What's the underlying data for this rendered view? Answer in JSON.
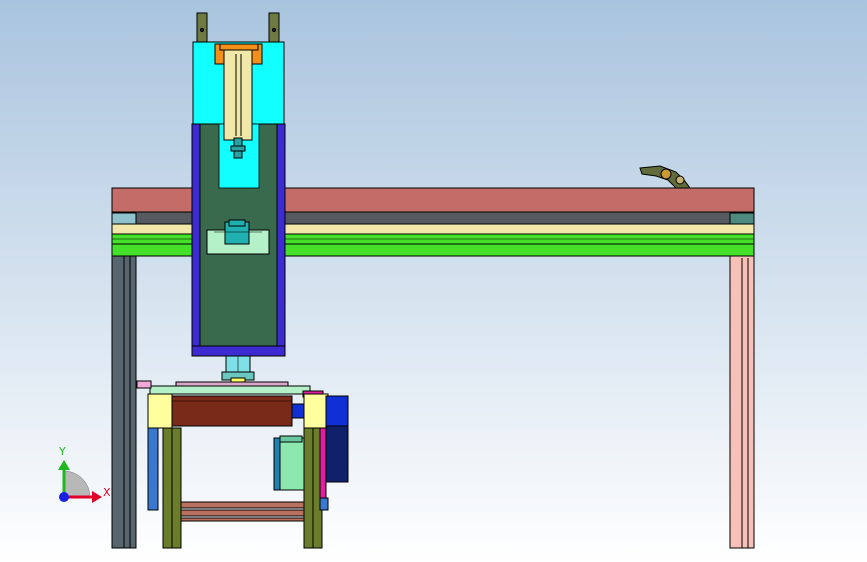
{
  "viewport": {
    "background_top": "#a9c4de",
    "background_bottom": "#ffffff"
  },
  "triad": {
    "x_label": "X",
    "y_label": "Y",
    "x_color": "#e0002a",
    "y_color": "#1fb81f",
    "z_color": "#1a20e0"
  },
  "colors": {
    "outline": "#000000",
    "beam_top": "#c46c68",
    "beam_bottom_band": "#545a60",
    "rail_yellow": "#f1e7a8",
    "rail_green": "#44e02a",
    "column_left": "#56656e",
    "column_right": "#f7c0b8",
    "ram_cyan": "#12ffff",
    "ram_body": "#3a6a4e",
    "ram_frame": "#3b2bd0",
    "guide_rod": "#6e7a42",
    "roller": "#7a2a18",
    "roller_cap": "#ffff9e",
    "motor_blue": "#1030d6",
    "motor_navy": "#10206a",
    "gearbox": "#8de8b0",
    "leg_green": "#6a7d2a",
    "magenta": "#e01ea0",
    "base_pink": "#b87060",
    "flange_orange": "#f39019",
    "light_green": "#b4f0c8"
  }
}
